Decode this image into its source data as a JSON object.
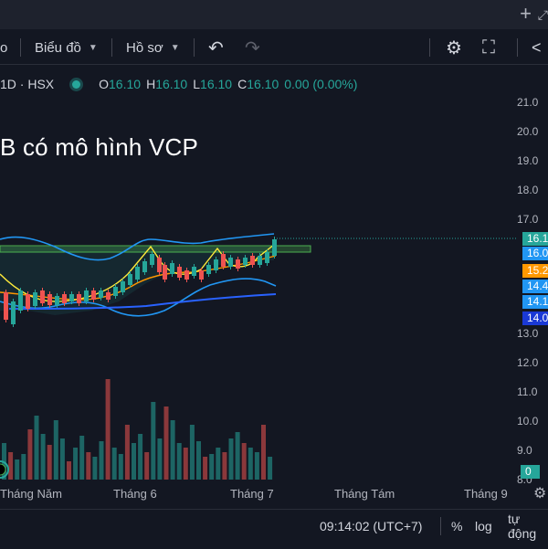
{
  "topbar": {
    "plus_icon": "+",
    "corner_icon": "⤢"
  },
  "toolbar": {
    "interval_fragment": "o",
    "chart_type_label": "Biểu đồ",
    "profile_label": "Hồ sơ",
    "undo_icon": "↶",
    "redo_icon": "↷",
    "settings_icon": "⚙",
    "fullscreen_icon": "⛶",
    "share_icon": "<"
  },
  "legend": {
    "symbol": "1D · HSX",
    "open_label": "O",
    "open": "16.10",
    "high_label": "H",
    "high": "16.10",
    "low_label": "L",
    "low": "16.10",
    "close_label": "C",
    "close": "16.10",
    "change": "0.00 (0.00%)"
  },
  "annotation_text": "B có mô hình VCP",
  "price_axis": [
    "21.0",
    "20.0",
    "19.0",
    "18.0",
    "17.0",
    "13.0",
    "12.0",
    "11.0",
    "10.0",
    "9.0",
    "8.0"
  ],
  "price_badges": [
    {
      "text": "16.1",
      "color": "#26a69a"
    },
    {
      "text": "16.0",
      "color": "#2196f3"
    },
    {
      "text": "15.2",
      "color": "#ff9800"
    },
    {
      "text": "14.4",
      "color": "#2196f3"
    },
    {
      "text": "14.1",
      "color": "#2196f3"
    },
    {
      "text": "14.0",
      "color": "#1a39d6"
    },
    {
      "text": "0",
      "color": "#26a69a"
    }
  ],
  "time_axis": [
    "Tháng Năm",
    "Tháng 6",
    "Tháng 7",
    "Tháng Tám",
    "Tháng 9"
  ],
  "statusbar": {
    "time": "09:14:02 (UTC+7)",
    "percent": "%",
    "log": "log",
    "auto": "tự động"
  },
  "colors": {
    "up": "#26a69a",
    "down": "#ef5350",
    "accent": "#2962ff"
  }
}
